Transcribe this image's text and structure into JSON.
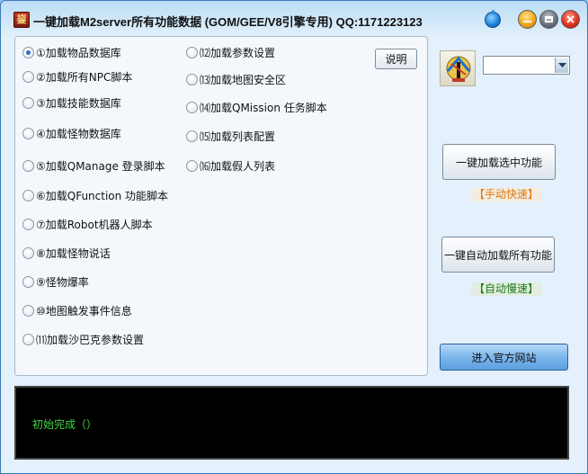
{
  "window": {
    "title": "一键加载M2server所有功能数据   (GOM/GEE/V8引擎专用)  QQ:1171223123",
    "icon_glyph": "鋆"
  },
  "options": {
    "col1": [
      {
        "label": "①加载物品数据库",
        "checked": true
      },
      {
        "label": "②加载所有NPC脚本",
        "checked": false
      },
      {
        "label": "③加载技能数据库",
        "checked": false
      },
      {
        "label": "④加载怪物数据库",
        "checked": false
      },
      {
        "label": "⑤加载QManage 登录脚本",
        "checked": false
      },
      {
        "label": "⑥加载QFunction 功能脚本",
        "checked": false
      },
      {
        "label": "⑦加载Robot机器人脚本",
        "checked": false
      },
      {
        "label": "⑧加载怪物说话",
        "checked": false
      },
      {
        "label": "⑨怪物爆率",
        "checked": false
      },
      {
        "label": "⑩地图触发事件信息",
        "checked": false
      },
      {
        "label": "⑾加载沙巴克参数设置",
        "checked": false
      }
    ],
    "col2": [
      {
        "label": "⑿加载参数设置",
        "checked": false
      },
      {
        "label": "⒀加载地图安全区",
        "checked": false
      },
      {
        "label": "⒁加载QMission 任务脚本",
        "checked": false
      },
      {
        "label": "⒂加载列表配置",
        "checked": false
      },
      {
        "label": "⒃加载假人列表",
        "checked": false
      }
    ]
  },
  "buttons": {
    "desc": "说明",
    "load_selected": "一键加载选中功能",
    "load_all_auto": "一键自动加载所有功能",
    "official_site": "进入官方网站"
  },
  "tags": {
    "manual_fast": "【手动快速】",
    "auto_slow": "【自动慢速】"
  },
  "combo": {
    "value": ""
  },
  "console": {
    "text": "初始完成（）"
  },
  "colors": {
    "accent_blue": "#5b9fe0",
    "console_green": "#3dd63d",
    "tag_orange": "#e07a10",
    "tag_green": "#1d7a1a"
  }
}
